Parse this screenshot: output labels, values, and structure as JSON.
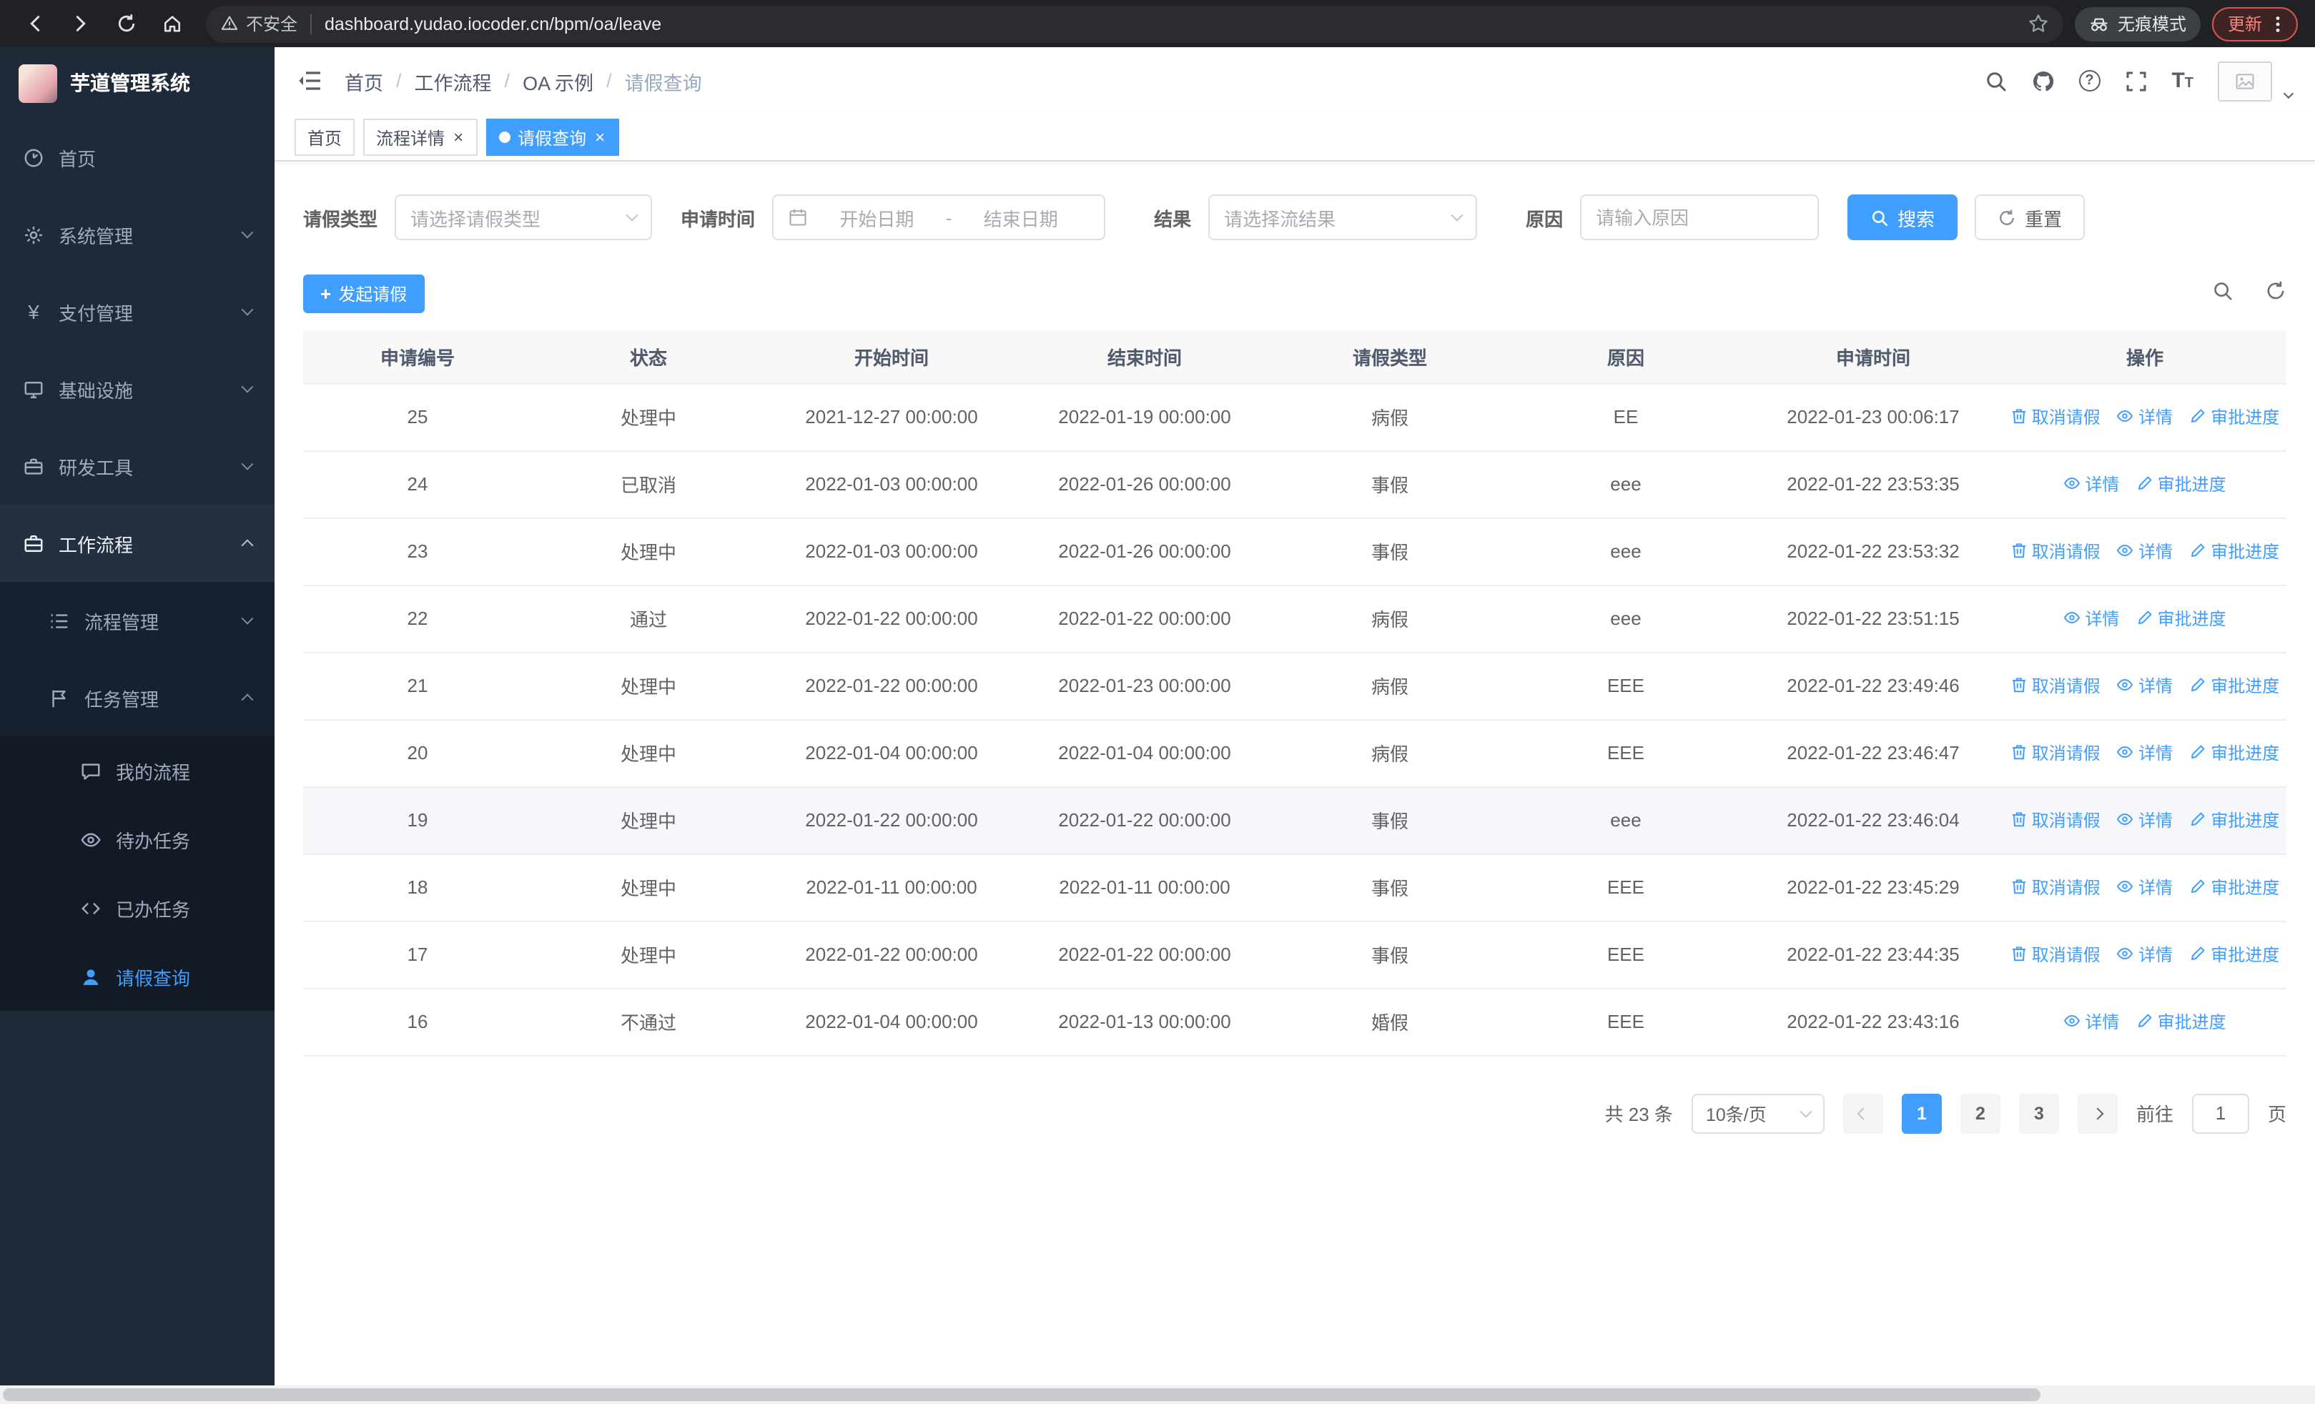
{
  "theme": {
    "primary": "#409eff",
    "link": "#409eff",
    "sidebar_bg": "#1f2a39",
    "chrome_bg": "#202124",
    "table_header_bg": "#f8f8f9"
  },
  "browser": {
    "security_chip": "不安全",
    "url": "dashboard.yudao.iocoder.cn/bpm/oa/leave",
    "incognito_label": "无痕模式",
    "update_label": "更新"
  },
  "sidebar": {
    "logo_title": "芋道管理系统",
    "menu": [
      {
        "label": "首页"
      },
      {
        "label": "系统管理"
      },
      {
        "label": "支付管理"
      },
      {
        "label": "基础设施"
      },
      {
        "label": "研发工具"
      },
      {
        "label": "工作流程"
      },
      {
        "label": "流程管理"
      },
      {
        "label": "任务管理"
      },
      {
        "label": "我的流程"
      },
      {
        "label": "待办任务"
      },
      {
        "label": "已办任务"
      },
      {
        "label": "请假查询"
      }
    ]
  },
  "header": {
    "breadcrumb": [
      {
        "label": "首页"
      },
      {
        "label": "工作流程"
      },
      {
        "label": "OA 示例"
      },
      {
        "label": "请假查询"
      }
    ]
  },
  "tabs": [
    {
      "label": "首页"
    },
    {
      "label": "流程详情"
    },
    {
      "label": "请假查询"
    }
  ],
  "filters": {
    "leave_type_label": "请假类型",
    "leave_type_placeholder": "请选择请假类型",
    "apply_time_label": "申请时间",
    "start_date_placeholder": "开始日期",
    "range_separator": "-",
    "end_date_placeholder": "结束日期",
    "result_label": "结果",
    "result_placeholder": "请选择流结果",
    "reason_label": "原因",
    "reason_placeholder": "请输入原因",
    "search_button": "搜索",
    "reset_button": "重置"
  },
  "toolbar": {
    "create_button": "发起请假"
  },
  "table": {
    "columns": [
      "申请编号",
      "状态",
      "开始时间",
      "结束时间",
      "请假类型",
      "原因",
      "申请时间",
      "操作"
    ],
    "action_labels": {
      "cancel": "取消请假",
      "detail": "详情",
      "progress": "审批进度"
    },
    "rows": [
      {
        "id": "25",
        "status": "处理中",
        "start_time": "2021-12-27 00:00:00",
        "end_time": "2022-01-19 00:00:00",
        "leave_type": "病假",
        "reason": "EE",
        "apply_time": "2022-01-23 00:06:17",
        "actions": [
          "cancel",
          "detail",
          "progress"
        ],
        "highlighted": false
      },
      {
        "id": "24",
        "status": "已取消",
        "start_time": "2022-01-03 00:00:00",
        "end_time": "2022-01-26 00:00:00",
        "leave_type": "事假",
        "reason": "eee",
        "apply_time": "2022-01-22 23:53:35",
        "actions": [
          "detail",
          "progress"
        ],
        "highlighted": false
      },
      {
        "id": "23",
        "status": "处理中",
        "start_time": "2022-01-03 00:00:00",
        "end_time": "2022-01-26 00:00:00",
        "leave_type": "事假",
        "reason": "eee",
        "apply_time": "2022-01-22 23:53:32",
        "actions": [
          "cancel",
          "detail",
          "progress"
        ],
        "highlighted": false
      },
      {
        "id": "22",
        "status": "通过",
        "start_time": "2022-01-22 00:00:00",
        "end_time": "2022-01-22 00:00:00",
        "leave_type": "病假",
        "reason": "eee",
        "apply_time": "2022-01-22 23:51:15",
        "actions": [
          "detail",
          "progress"
        ],
        "highlighted": false
      },
      {
        "id": "21",
        "status": "处理中",
        "start_time": "2022-01-22 00:00:00",
        "end_time": "2022-01-23 00:00:00",
        "leave_type": "病假",
        "reason": "EEE",
        "apply_time": "2022-01-22 23:49:46",
        "actions": [
          "cancel",
          "detail",
          "progress"
        ],
        "highlighted": false
      },
      {
        "id": "20",
        "status": "处理中",
        "start_time": "2022-01-04 00:00:00",
        "end_time": "2022-01-04 00:00:00",
        "leave_type": "病假",
        "reason": "EEE",
        "apply_time": "2022-01-22 23:46:47",
        "actions": [
          "cancel",
          "detail",
          "progress"
        ],
        "highlighted": false
      },
      {
        "id": "19",
        "status": "处理中",
        "start_time": "2022-01-22 00:00:00",
        "end_time": "2022-01-22 00:00:00",
        "leave_type": "事假",
        "reason": "eee",
        "apply_time": "2022-01-22 23:46:04",
        "actions": [
          "cancel",
          "detail",
          "progress"
        ],
        "highlighted": true
      },
      {
        "id": "18",
        "status": "处理中",
        "start_time": "2022-01-11 00:00:00",
        "end_time": "2022-01-11 00:00:00",
        "leave_type": "事假",
        "reason": "EEE",
        "apply_time": "2022-01-22 23:45:29",
        "actions": [
          "cancel",
          "detail",
          "progress"
        ],
        "highlighted": false
      },
      {
        "id": "17",
        "status": "处理中",
        "start_time": "2022-01-22 00:00:00",
        "end_time": "2022-01-22 00:00:00",
        "leave_type": "事假",
        "reason": "EEE",
        "apply_time": "2022-01-22 23:44:35",
        "actions": [
          "cancel",
          "detail",
          "progress"
        ],
        "highlighted": false
      },
      {
        "id": "16",
        "status": "不通过",
        "start_time": "2022-01-04 00:00:00",
        "end_time": "2022-01-13 00:00:00",
        "leave_type": "婚假",
        "reason": "EEE",
        "apply_time": "2022-01-22 23:43:16",
        "actions": [
          "detail",
          "progress"
        ],
        "highlighted": false
      }
    ]
  },
  "pagination": {
    "total_text": "共 23 条",
    "page_size_text": "10条/页",
    "pages": [
      "1",
      "2",
      "3"
    ],
    "active_page": "1",
    "goto_prefix": "前往",
    "goto_value": "1",
    "goto_suffix": "页"
  }
}
